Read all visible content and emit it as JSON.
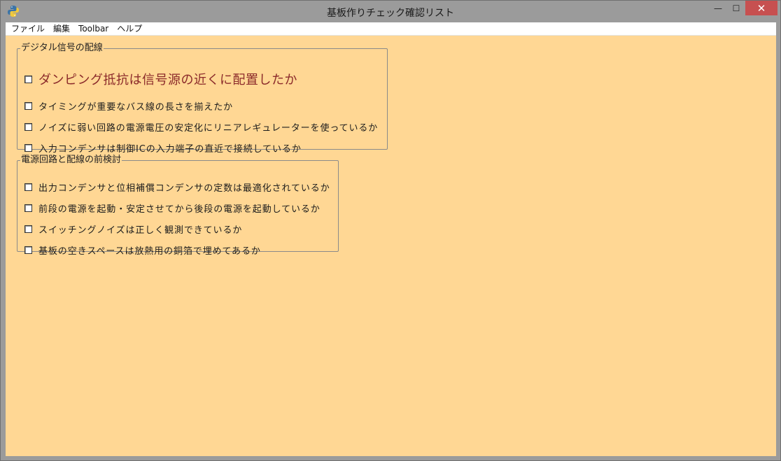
{
  "window": {
    "title": "基板作りチェック確認リスト",
    "close_symbol": "✕",
    "minimize_symbol": "—",
    "maximize_symbol": "☐"
  },
  "menu": [
    "ファイル",
    "編集",
    "Toolbar",
    "ヘルプ"
  ],
  "groups": [
    {
      "title": "デジタル信号の配線",
      "items": [
        {
          "label": "ダンピング抵抗は信号源の近くに配置したか",
          "checked": false,
          "highlighted": true
        },
        {
          "label": "タイミングが重要なバス線の長さを揃えたか",
          "checked": false
        },
        {
          "label": "ノイズに弱い回路の電源電圧の安定化にリニアレギュレーターを使っているか",
          "checked": false
        },
        {
          "label": "入力コンデンサは制御ICの入力端子の直近で接続しているか",
          "checked": false
        }
      ]
    },
    {
      "title": "電源回路と配線の前検討",
      "items": [
        {
          "label": "出力コンデンサと位相補償コンデンサの定数は最適化されているか",
          "checked": false
        },
        {
          "label": "前段の電源を起動・安定させてから後段の電源を起動しているか",
          "checked": false
        },
        {
          "label": "スイッチングノイズは正しく観測できているか",
          "checked": false
        },
        {
          "label": "基板の空きスペースは放熱用の銅箔で埋めてあるか",
          "checked": false
        }
      ]
    }
  ],
  "colors": {
    "client_bg": "#ffd794",
    "titlebar_bg": "#9b9b9b",
    "close_button": "#c75050",
    "highlight_text": "#8b2a2a"
  }
}
